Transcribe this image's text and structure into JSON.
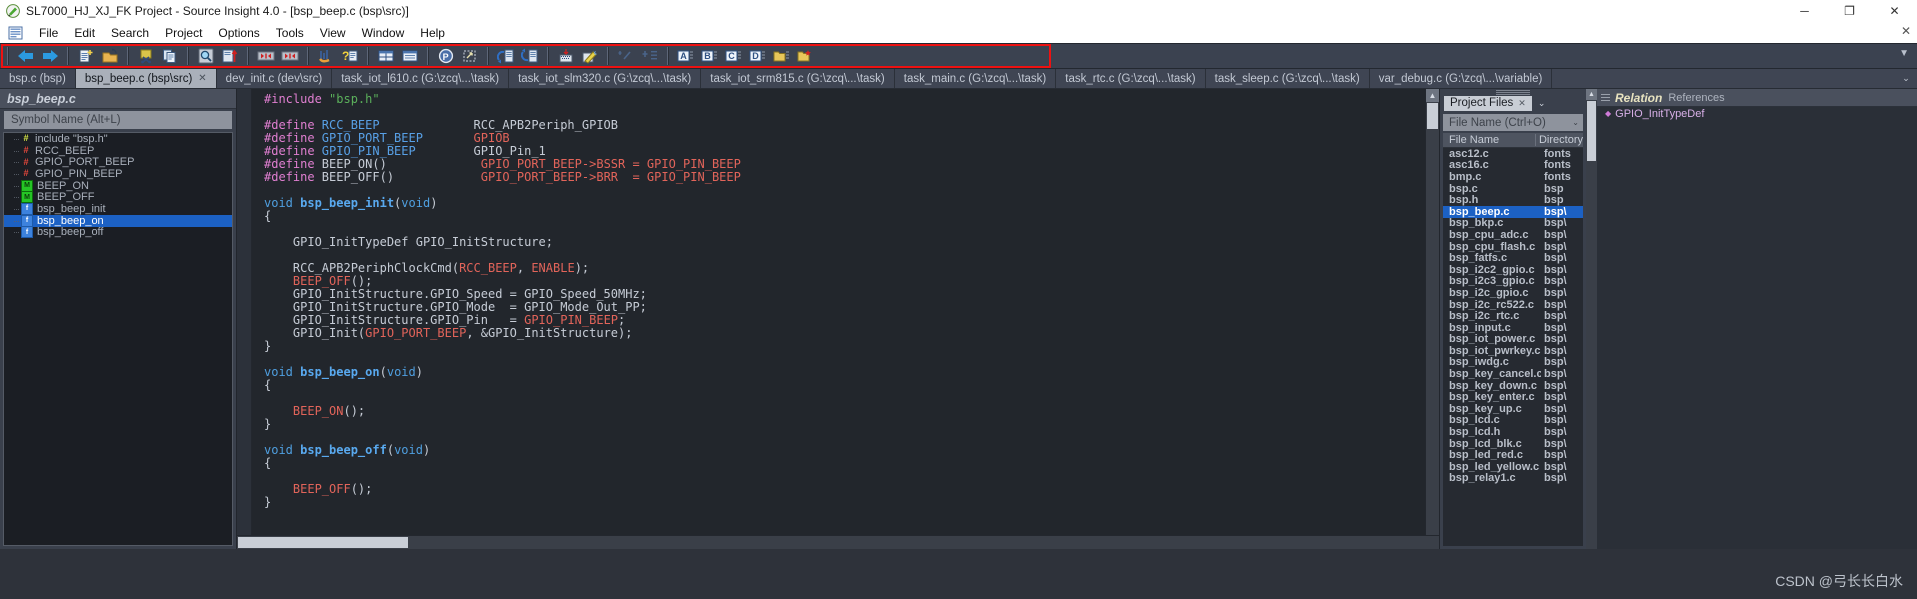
{
  "window": {
    "title": "SL7000_HJ_XJ_FK Project - Source Insight 4.0 - [bsp_beep.c (bsp\\src)]",
    "app_icon": "source-insight-icon",
    "minimize": "─",
    "maximize": "❐",
    "close": "✕",
    "inner_close": "✕"
  },
  "menu": {
    "doc_icon": "document-icon",
    "items": [
      "File",
      "Edit",
      "Search",
      "Project",
      "Options",
      "Tools",
      "View",
      "Window",
      "Help"
    ]
  },
  "toolbar": {
    "overflow_arrow": "▼",
    "groups": [
      {
        "buttons": [
          {
            "name": "back-icon",
            "label": "Back"
          },
          {
            "name": "forward-icon",
            "label": "Forward"
          }
        ]
      },
      {
        "buttons": [
          {
            "name": "new-file-icon",
            "label": "New File"
          },
          {
            "name": "open-file-icon",
            "label": "Open File"
          }
        ]
      },
      {
        "buttons": [
          {
            "name": "cut-icon",
            "label": "Cut"
          },
          {
            "name": "copy-icon",
            "label": "Copy"
          }
        ]
      },
      {
        "buttons": [
          {
            "name": "search-icon",
            "label": "Search"
          },
          {
            "name": "replace-icon",
            "label": "Replace"
          }
        ]
      },
      {
        "buttons": [
          {
            "name": "jump-prev-icon",
            "label": "Jump Back"
          },
          {
            "name": "jump-next-icon",
            "label": "Jump Forward"
          }
        ]
      },
      {
        "buttons": [
          {
            "name": "symbol-window-icon",
            "label": "Symbol Window"
          },
          {
            "name": "context-help-icon",
            "label": "Context Help"
          }
        ]
      },
      {
        "buttons": [
          {
            "name": "tile-windows-icon",
            "label": "Tile Windows"
          },
          {
            "name": "single-window-icon",
            "label": "Single Window"
          }
        ]
      },
      {
        "buttons": [
          {
            "name": "project-window-icon",
            "label": "Project Window"
          },
          {
            "name": "project-settings-icon",
            "label": "Project Settings"
          }
        ]
      },
      {
        "buttons": [
          {
            "name": "sync-file-in-icon",
            "label": "Sync File"
          },
          {
            "name": "sync-file-out-icon",
            "label": "Sync File Out"
          }
        ]
      },
      {
        "buttons": [
          {
            "name": "rebuild-project-icon",
            "label": "Rebuild Project"
          },
          {
            "name": "smart-rename-icon",
            "label": "Smart Rename"
          }
        ]
      },
      {
        "buttons": [
          {
            "name": "add-bookmark-icon",
            "label": "Add Bookmark"
          },
          {
            "name": "add-list-icon",
            "label": "Add to List"
          }
        ]
      },
      {
        "buttons": [
          {
            "name": "clip-a-icon",
            "label": "Clip A"
          },
          {
            "name": "clip-b-icon",
            "label": "Clip B"
          },
          {
            "name": "clip-c-icon",
            "label": "Clip C"
          },
          {
            "name": "clip-d-icon",
            "label": "Clip D"
          },
          {
            "name": "clip-folder-icon",
            "label": "Clip Folder"
          },
          {
            "name": "clip-folder-new-icon",
            "label": "New Clip Folder"
          }
        ]
      }
    ]
  },
  "tabs": {
    "overflow_icon": "⌄",
    "items": [
      {
        "label": "bsp.c (bsp)",
        "active": false,
        "closable": false
      },
      {
        "label": "bsp_beep.c (bsp\\src)",
        "active": true,
        "closable": true,
        "close": "✕"
      },
      {
        "label": "dev_init.c (dev\\src)",
        "active": false,
        "closable": false
      },
      {
        "label": "task_iot_l610.c (G:\\zcq\\...\\task)",
        "active": false,
        "closable": false
      },
      {
        "label": "task_iot_slm320.c (G:\\zcq\\...\\task)",
        "active": false,
        "closable": false
      },
      {
        "label": "task_iot_srm815.c (G:\\zcq\\...\\task)",
        "active": false,
        "closable": false
      },
      {
        "label": "task_main.c (G:\\zcq\\...\\task)",
        "active": false,
        "closable": false
      },
      {
        "label": "task_rtc.c (G:\\zcq\\...\\task)",
        "active": false,
        "closable": false
      },
      {
        "label": "task_sleep.c (G:\\zcq\\...\\task)",
        "active": false,
        "closable": false
      },
      {
        "label": "var_debug.c (G:\\zcq\\...\\variable)",
        "active": false,
        "closable": false
      }
    ]
  },
  "symbol_panel": {
    "title": "bsp_beep.c",
    "search_placeholder": "Symbol Name (Alt+L)",
    "items": [
      {
        "label": "include \"bsp.h\"",
        "icon": "hash-yellow",
        "glyph": "#",
        "selected": false
      },
      {
        "label": "RCC_BEEP",
        "icon": "hash-red",
        "glyph": "#",
        "selected": false
      },
      {
        "label": "GPIO_PORT_BEEP",
        "icon": "hash-red",
        "glyph": "#",
        "selected": false
      },
      {
        "label": "GPIO_PIN_BEEP",
        "icon": "hash-red",
        "glyph": "#",
        "selected": false
      },
      {
        "label": "BEEP_ON",
        "icon": "m-green",
        "glyph": "M",
        "selected": false
      },
      {
        "label": "BEEP_OFF",
        "icon": "m-green",
        "glyph": "M",
        "selected": false
      },
      {
        "label": "bsp_beep_init",
        "icon": "f-blue",
        "glyph": "f",
        "selected": false
      },
      {
        "label": "bsp_beep_on",
        "icon": "f-blue",
        "glyph": "f",
        "selected": true
      },
      {
        "label": "bsp_beep_off",
        "icon": "f-blue",
        "glyph": "f",
        "selected": false
      }
    ]
  },
  "editor": {
    "lines": [
      [
        {
          "t": "#include ",
          "c": "pre"
        },
        {
          "t": "\"bsp.h\"",
          "c": "str"
        }
      ],
      [],
      [
        {
          "t": "#define ",
          "c": "pre"
        },
        {
          "t": "RCC_BEEP",
          "c": "id"
        },
        {
          "t": "             ",
          "c": "plain"
        },
        {
          "t": "RCC_APB2Periph_GPIOB",
          "c": "plain"
        }
      ],
      [
        {
          "t": "#define ",
          "c": "pre"
        },
        {
          "t": "GPIO_PORT_BEEP",
          "c": "id"
        },
        {
          "t": "       ",
          "c": "plain"
        },
        {
          "t": "GPIOB",
          "c": "mac"
        }
      ],
      [
        {
          "t": "#define ",
          "c": "pre"
        },
        {
          "t": "GPIO_PIN_BEEP",
          "c": "id"
        },
        {
          "t": "        ",
          "c": "plain"
        },
        {
          "t": "GPIO_Pin_1",
          "c": "plain"
        }
      ],
      [
        {
          "t": "#define ",
          "c": "pre"
        },
        {
          "t": "BEEP_ON",
          "c": "plain"
        },
        {
          "t": "()",
          "c": "plain"
        },
        {
          "t": "             ",
          "c": "plain"
        },
        {
          "t": "GPIO_PORT_BEEP->BSSR = GPIO_PIN_BEEP",
          "c": "mac"
        }
      ],
      [
        {
          "t": "#define ",
          "c": "pre"
        },
        {
          "t": "BEEP_OFF",
          "c": "plain"
        },
        {
          "t": "()",
          "c": "plain"
        },
        {
          "t": "            ",
          "c": "plain"
        },
        {
          "t": "GPIO_PORT_BEEP->BRR  = GPIO_PIN_BEEP",
          "c": "mac"
        }
      ],
      [],
      [
        {
          "t": "void ",
          "c": "kw"
        },
        {
          "t": "bsp_beep_init",
          "c": "fn"
        },
        {
          "t": "(",
          "c": "plain"
        },
        {
          "t": "void",
          "c": "kw"
        },
        {
          "t": ")",
          "c": "plain"
        }
      ],
      [
        {
          "t": "{",
          "c": "plain"
        }
      ],
      [],
      [
        {
          "t": "    GPIO_InitTypeDef GPIO_InitStructure;",
          "c": "plain"
        }
      ],
      [],
      [
        {
          "t": "    RCC_APB2PeriphClockCmd",
          "c": "plain"
        },
        {
          "t": "(",
          "c": "plain"
        },
        {
          "t": "RCC_BEEP",
          "c": "mac"
        },
        {
          "t": ", ",
          "c": "plain"
        },
        {
          "t": "ENABLE",
          "c": "mac"
        },
        {
          "t": ");",
          "c": "plain"
        }
      ],
      [
        {
          "t": "    ",
          "c": "plain"
        },
        {
          "t": "BEEP_OFF",
          "c": "mac"
        },
        {
          "t": "();",
          "c": "plain"
        }
      ],
      [
        {
          "t": "    GPIO_InitStructure.GPIO_Speed = GPIO_Speed_50MHz;",
          "c": "plain"
        }
      ],
      [
        {
          "t": "    GPIO_InitStructure.GPIO_Mode  = GPIO_Mode_Out_PP;",
          "c": "plain"
        }
      ],
      [
        {
          "t": "    GPIO_InitStructure.GPIO_Pin   = ",
          "c": "plain"
        },
        {
          "t": "GPIO_PIN_BEEP",
          "c": "mac"
        },
        {
          "t": ";",
          "c": "plain"
        }
      ],
      [
        {
          "t": "    GPIO_Init",
          "c": "plain"
        },
        {
          "t": "(",
          "c": "plain"
        },
        {
          "t": "GPIO_PORT_BEEP",
          "c": "mac"
        },
        {
          "t": ", &GPIO_InitStructure);",
          "c": "plain"
        }
      ],
      [
        {
          "t": "}",
          "c": "plain"
        }
      ],
      [],
      [
        {
          "t": "void ",
          "c": "kw"
        },
        {
          "t": "bsp_beep_on",
          "c": "fn"
        },
        {
          "t": "(",
          "c": "plain"
        },
        {
          "t": "void",
          "c": "kw"
        },
        {
          "t": ")",
          "c": "plain"
        }
      ],
      [
        {
          "t": "{",
          "c": "plain"
        }
      ],
      [],
      [
        {
          "t": "    ",
          "c": "plain"
        },
        {
          "t": "BEEP_ON",
          "c": "mac"
        },
        {
          "t": "();",
          "c": "plain"
        }
      ],
      [
        {
          "t": "}",
          "c": "plain"
        }
      ],
      [],
      [
        {
          "t": "void ",
          "c": "kw"
        },
        {
          "t": "bsp_beep_off",
          "c": "fn"
        },
        {
          "t": "(",
          "c": "plain"
        },
        {
          "t": "void",
          "c": "kw"
        },
        {
          "t": ")",
          "c": "plain"
        }
      ],
      [
        {
          "t": "{",
          "c": "plain"
        }
      ],
      [],
      [
        {
          "t": "    ",
          "c": "plain"
        },
        {
          "t": "BEEP_OFF",
          "c": "mac"
        },
        {
          "t": "();",
          "c": "plain"
        }
      ],
      [
        {
          "t": "}",
          "c": "plain"
        }
      ]
    ],
    "scroll_up": "▲",
    "scroll_down": "▼"
  },
  "project_pane": {
    "tab_label": "Project Files",
    "tab_close": "✕",
    "caret": "⌄",
    "filter_placeholder": "File Name (Ctrl+O)",
    "filter_caret": "⌄",
    "columns": [
      "File Name",
      "Directory"
    ],
    "scroll_up": "▲",
    "rows": [
      {
        "name": "asc12.c",
        "dir": "fonts",
        "selected": false
      },
      {
        "name": "asc16.c",
        "dir": "fonts",
        "selected": false
      },
      {
        "name": "bmp.c",
        "dir": "fonts",
        "selected": false
      },
      {
        "name": "bsp.c",
        "dir": "bsp",
        "selected": false
      },
      {
        "name": "bsp.h",
        "dir": "bsp",
        "selected": false
      },
      {
        "name": "bsp_beep.c",
        "dir": "bsp\\",
        "selected": true
      },
      {
        "name": "bsp_bkp.c",
        "dir": "bsp\\",
        "selected": false
      },
      {
        "name": "bsp_cpu_adc.c",
        "dir": "bsp\\",
        "selected": false
      },
      {
        "name": "bsp_cpu_flash.c",
        "dir": "bsp\\",
        "selected": false
      },
      {
        "name": "bsp_fatfs.c",
        "dir": "bsp\\",
        "selected": false
      },
      {
        "name": "bsp_i2c2_gpio.c",
        "dir": "bsp\\",
        "selected": false
      },
      {
        "name": "bsp_i2c3_gpio.c",
        "dir": "bsp\\",
        "selected": false
      },
      {
        "name": "bsp_i2c_gpio.c",
        "dir": "bsp\\",
        "selected": false
      },
      {
        "name": "bsp_i2c_rc522.c",
        "dir": "bsp\\",
        "selected": false
      },
      {
        "name": "bsp_i2c_rtc.c",
        "dir": "bsp\\",
        "selected": false
      },
      {
        "name": "bsp_input.c",
        "dir": "bsp\\",
        "selected": false
      },
      {
        "name": "bsp_iot_power.c",
        "dir": "bsp\\",
        "selected": false
      },
      {
        "name": "bsp_iot_pwrkey.c",
        "dir": "bsp\\",
        "selected": false
      },
      {
        "name": "bsp_iwdg.c",
        "dir": "bsp\\",
        "selected": false
      },
      {
        "name": "bsp_key_cancel.c",
        "dir": "bsp\\",
        "selected": false
      },
      {
        "name": "bsp_key_down.c",
        "dir": "bsp\\",
        "selected": false
      },
      {
        "name": "bsp_key_enter.c",
        "dir": "bsp\\",
        "selected": false
      },
      {
        "name": "bsp_key_up.c",
        "dir": "bsp\\",
        "selected": false
      },
      {
        "name": "bsp_lcd.c",
        "dir": "bsp\\",
        "selected": false
      },
      {
        "name": "bsp_lcd.h",
        "dir": "bsp\\",
        "selected": false
      },
      {
        "name": "bsp_lcd_blk.c",
        "dir": "bsp\\",
        "selected": false
      },
      {
        "name": "bsp_led_red.c",
        "dir": "bsp\\",
        "selected": false
      },
      {
        "name": "bsp_led_yellow.c",
        "dir": "bsp\\",
        "selected": false
      },
      {
        "name": "bsp_relay1.c",
        "dir": "bsp\\",
        "selected": false
      }
    ]
  },
  "relation_pane": {
    "title": "Relation",
    "subtitle": "References",
    "items": [
      {
        "label": "GPIO_InitTypeDef",
        "marker": "◆"
      }
    ]
  },
  "watermark": "CSDN @弓长长白水",
  "colors": {
    "accent_selection": "#1c61c4",
    "toolbar_bg": "#3b4250",
    "editor_bg": "#22262c",
    "panel_bg": "#3a404c",
    "highlight_box": "#ee1111"
  }
}
